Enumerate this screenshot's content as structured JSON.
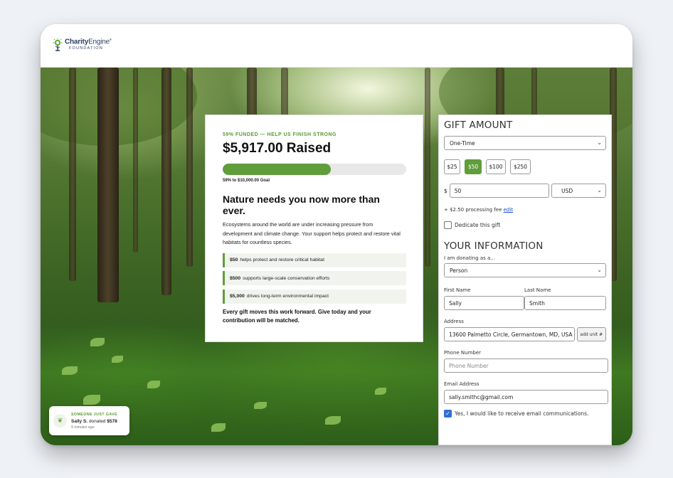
{
  "brand": {
    "name_bold": "Charity",
    "name_light": "Engine",
    "trademark": "®",
    "subtitle": "FOUNDATION",
    "logo_icon": "tree-leaf-icon"
  },
  "campaign": {
    "kicker": "59% FUNDED — HELP US FINISH STRONG",
    "raised": "$5,917.00 Raised",
    "progress_percent": 59,
    "goal_text": "59% to $10,000.00 Goal",
    "headline": "Nature needs you now more than ever.",
    "body": "Ecosystems around the world are under increasing pressure from development and climate change. Your support helps protect and restore vital habitats for countless species.",
    "impact": [
      {
        "amount": "$50",
        "text": "helps protect and restore critical habitat"
      },
      {
        "amount": "$500",
        "text": "supports large-scale conservation efforts"
      },
      {
        "amount": "$5,000",
        "text": "drives long-term environmental impact"
      }
    ],
    "closing": "Every gift moves this work forward. Give today and your contribution will be matched."
  },
  "form": {
    "gift_title": "GIFT AMOUNT",
    "frequency": "One-Time",
    "amount_options": [
      "$25",
      "$50",
      "$100",
      "$250"
    ],
    "selected_amount_index": 1,
    "currency_symbol": "$",
    "amount_value": "50",
    "currency": "USD",
    "fee_text": "+ $2.50 processing fee",
    "fee_link": "edit",
    "dedicate_label": "Dedicate this gift",
    "dedicate_checked": false,
    "info_title": "YOUR INFORMATION",
    "donating_as_label": "I am donating as a...",
    "donating_as": "Person",
    "first_name_label": "First Name",
    "first_name": "Sally",
    "last_name_label": "Last Name",
    "last_name": "Smith",
    "address_label": "Address",
    "address": "13600 Palmetto Circle, Germantown, MD, USA",
    "add_unit": "add unit #",
    "phone_label": "Phone Number",
    "phone_placeholder": "Phone Number",
    "email_label": "Email Address",
    "email": "sally.smithc@gmail.com",
    "optin_label": "Yes, I would like to receive email communications.",
    "optin_checked": true
  },
  "toast": {
    "kicker": "SOMEONE JUST GAVE",
    "donor": "Sally S.",
    "action": "donated",
    "amount": "$578",
    "time": "9 minutes ago",
    "icon": "leaf-icon"
  },
  "colors": {
    "accent_green": "#5f9e3a",
    "link_blue": "#1a4ccf",
    "checkbox_blue": "#2f6fd6",
    "brand_navy": "#2c3e66"
  }
}
